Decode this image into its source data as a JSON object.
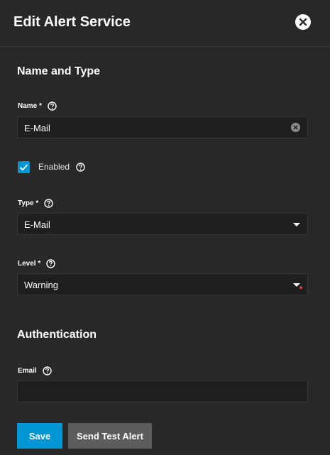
{
  "dialog": {
    "title": "Edit Alert Service"
  },
  "sections": {
    "name_and_type": "Name and Type",
    "authentication": "Authentication"
  },
  "fields": {
    "name": {
      "label": "Name *",
      "value": "E-Mail"
    },
    "enabled": {
      "label": "Enabled",
      "checked": true
    },
    "type": {
      "label": "Type *",
      "value": "E-Mail"
    },
    "level": {
      "label": "Level *",
      "value": "Warning"
    },
    "email": {
      "label": "Email",
      "value": ""
    }
  },
  "buttons": {
    "save": "Save",
    "send_test": "Send Test Alert"
  },
  "icons": {
    "close": "close-icon",
    "help": "help-circle-icon",
    "clear": "clear-circle-icon",
    "dropdown": "chevron-down-icon",
    "check": "check-icon"
  },
  "colors": {
    "background": "#282828",
    "input_background": "#1f1f1f",
    "accent": "#0095d5",
    "secondary_button": "#5d5d5d",
    "required_dot": "#e03b3b"
  }
}
